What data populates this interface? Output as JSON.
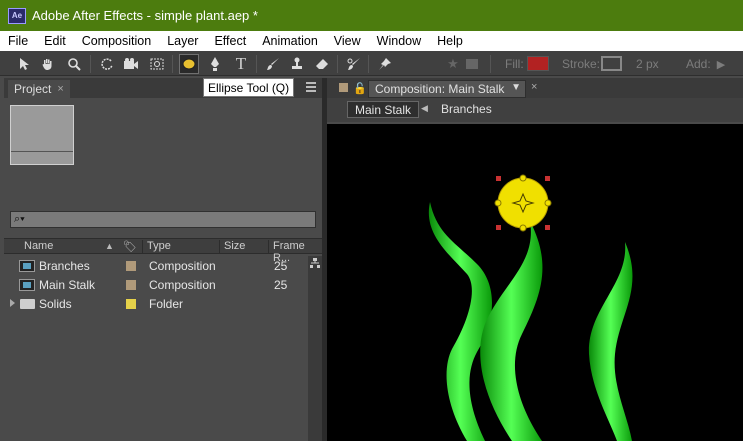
{
  "window": {
    "app_icon_text": "Ae",
    "title": "Adobe After Effects - simple plant.aep *"
  },
  "menu": [
    "File",
    "Edit",
    "Composition",
    "Layer",
    "Effect",
    "Animation",
    "View",
    "Window",
    "Help"
  ],
  "toolbar": {
    "active_tool_tooltip": "Ellipse Tool (Q)",
    "fill_label": "Fill:",
    "fill_color": "#b22222",
    "stroke_label": "Stroke:",
    "stroke_width": "2 px",
    "add_label": "Add:"
  },
  "project": {
    "tab_label": "Project",
    "columns": [
      "Name",
      "Type",
      "Size",
      "Frame R..."
    ],
    "items": [
      {
        "name": "Branches",
        "type": "Composition",
        "frame_rate": "25",
        "label_color": "#b09a7a",
        "kind": "comp"
      },
      {
        "name": "Main Stalk",
        "type": "Composition",
        "frame_rate": "25",
        "label_color": "#b09a7a",
        "kind": "comp"
      },
      {
        "name": "Solids",
        "type": "Folder",
        "frame_rate": "",
        "label_color": "#e6d24a",
        "kind": "folder"
      }
    ]
  },
  "composition": {
    "tab_label": "Composition: Main Stalk",
    "breadcrumb_active": "Main Stalk",
    "breadcrumb_next": "Branches",
    "viewer_background": "#000000",
    "shape_fill": "#f0e000",
    "stalk_color": "#22dd22"
  }
}
